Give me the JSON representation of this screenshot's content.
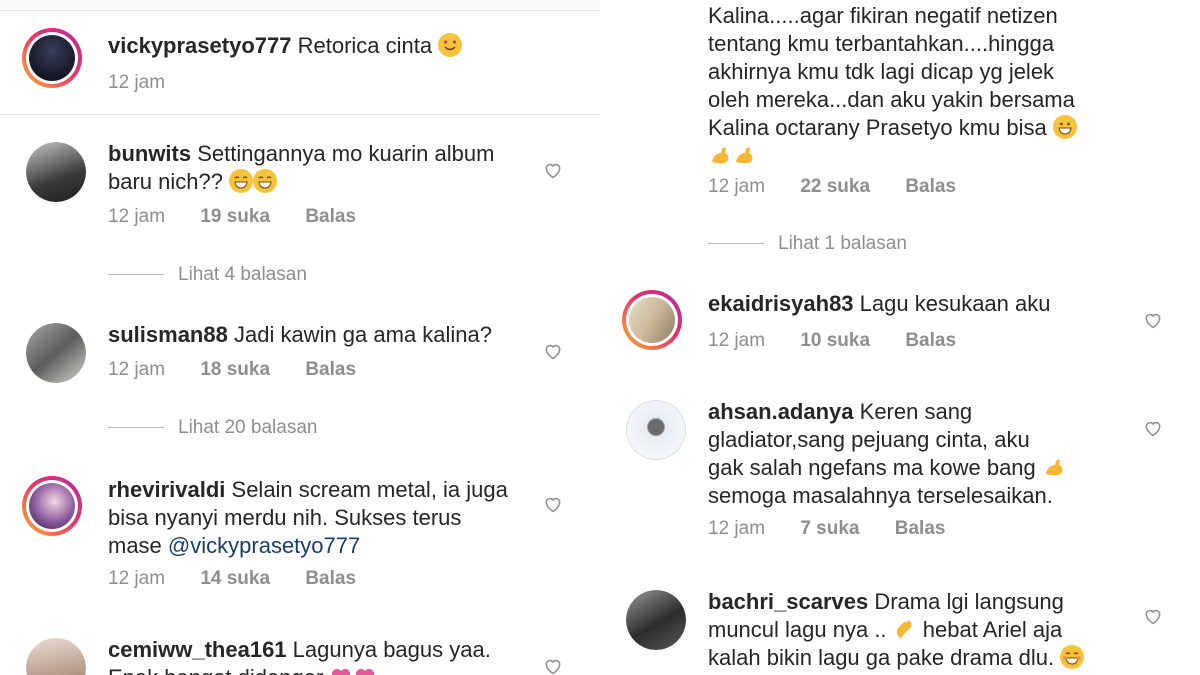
{
  "left": {
    "caption": {
      "username": "vickyprasetyo777",
      "text": "Retorica cinta",
      "time": "12 jam"
    },
    "comments": [
      {
        "username": "bunwits",
        "text_lines": [
          "Settingannya mo kuarin album",
          "baru nich??"
        ],
        "time": "12 jam",
        "likes": "19 suka",
        "reply": "Balas",
        "view_replies": "Lihat 4 balasan"
      },
      {
        "username": "sulisman88",
        "text_lines": [
          "Jadi kawin ga ama kalina?"
        ],
        "time": "12 jam",
        "likes": "18 suka",
        "reply": "Balas",
        "view_replies": "Lihat 20 balasan"
      },
      {
        "username": "rhevirivaldi",
        "text_lines": [
          "Selain scream metal, ia juga",
          "bisa nyanyi merdu nih. Sukses terus",
          "mase"
        ],
        "mention": "@vickyprasetyo777",
        "time": "12 jam",
        "likes": "14 suka",
        "reply": "Balas"
      },
      {
        "username": "cemiww_thea161",
        "text_lines": [
          "Lagunya bagus yaa.",
          "Enak banget didenger"
        ]
      }
    ]
  },
  "right": {
    "continued": {
      "text_lines": [
        "Kalina.....agar fikiran negatif netizen",
        "tentang kmu terbantahkan....hingga",
        "akhirnya kmu tdk lagi dicap yg jelek",
        "oleh mereka...dan aku yakin bersama",
        "Kalina octarany Prasetyo kmu bisa"
      ],
      "time": "12 jam",
      "likes": "22 suka",
      "reply": "Balas",
      "view_replies": "Lihat 1 balasan"
    },
    "comments": [
      {
        "username": "ekaidrisyah83",
        "text_lines": [
          "Lagu kesukaan aku"
        ],
        "time": "12 jam",
        "likes": "10 suka",
        "reply": "Balas"
      },
      {
        "username": "ahsan.adanya",
        "text_lines": [
          "Keren sang",
          "gladiator,sang pejuang cinta, aku",
          "gak salah ngefans ma kowe bang",
          "semoga masalahnya terselesaikan."
        ],
        "time": "12 jam",
        "likes": "7 suka",
        "reply": "Balas"
      },
      {
        "username": "bachri_scarves",
        "text_lines": [
          "Drama lgi langsung",
          "muncul lagu nya ..",
          "hebat Ariel aja",
          "kalah bikin lagu ga pake drama dlu."
        ]
      }
    ]
  },
  "colors": {
    "text": "#262626",
    "meta": "#8e8e8e",
    "mention": "#1a3e6b",
    "divider": "#e6e6e6"
  }
}
